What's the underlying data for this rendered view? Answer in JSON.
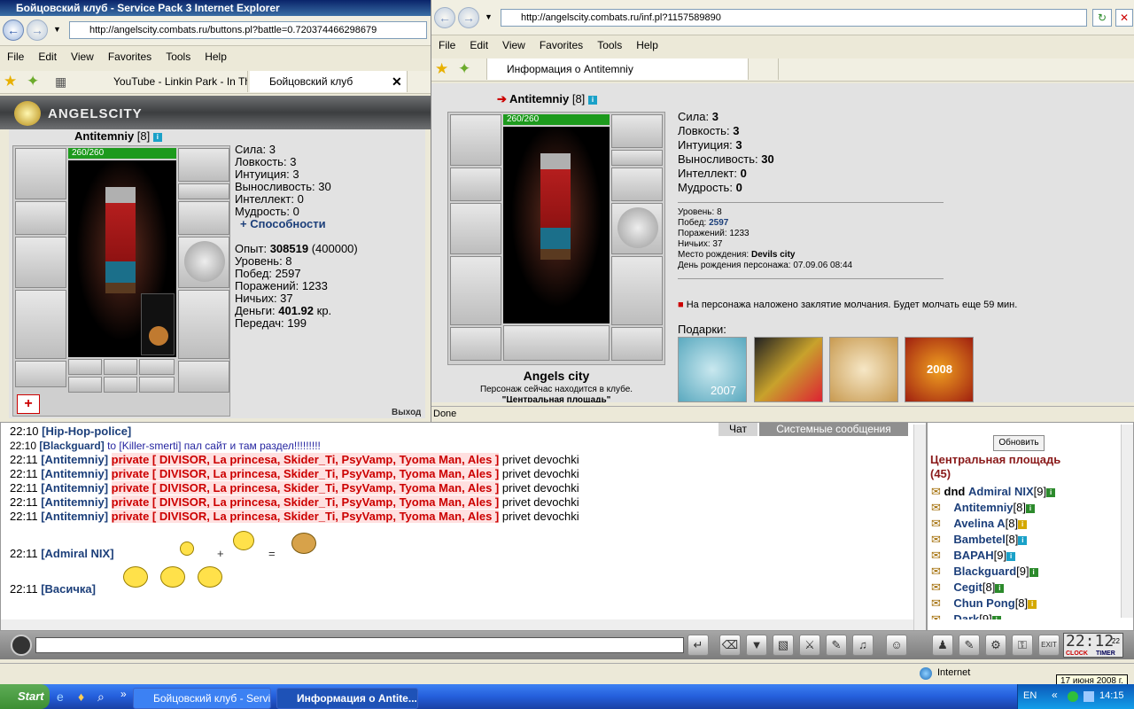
{
  "left_window": {
    "title": "Бойцовский клуб - Service Pack 3 Internet Explorer",
    "address": "http://angelscity.combats.ru/buttons.pl?battle=0.720374466298679",
    "menu": [
      "File",
      "Edit",
      "View",
      "Favorites",
      "Tools",
      "Help"
    ],
    "tabs": [
      "YouTube - Linkin Park - In Th...",
      "Бойцовский клуб"
    ],
    "site_logo": "ANGELSCITY",
    "character": {
      "name": "Antitemniy",
      "level": "[8]",
      "hp": "260/260"
    },
    "stats": [
      {
        "label": "Сила:",
        "value": "3"
      },
      {
        "label": "Ловкость:",
        "value": "3"
      },
      {
        "label": "Интуиция:",
        "value": "3"
      },
      {
        "label": "Выносливость:",
        "value": "30"
      },
      {
        "label": "Интеллект:",
        "value": "0"
      },
      {
        "label": "Мудрость:",
        "value": "0"
      }
    ],
    "abilities_link": "+ Способности",
    "exp_label": "Опыт:",
    "exp_value": "308519",
    "exp_next": "(400000)",
    "level_line": "Уровень: 8",
    "wins_line": "Побед: 2597",
    "losses_line": "Поражений: 1233",
    "draws_line": "Ничьих: 37",
    "money_label": "Деньги:",
    "money_value": "401.92",
    "money_unit": "кр.",
    "transfers_line": "Передач: 199",
    "exit_text": "Выход"
  },
  "right_window": {
    "address": "http://angelscity.combats.ru/inf.pl?1157589890",
    "menu": [
      "File",
      "Edit",
      "View",
      "Favorites",
      "Tools",
      "Help"
    ],
    "tab": "Информация о Antitemniy",
    "character": {
      "name": "Antitemniy",
      "level": "[8]",
      "hp": "260/260"
    },
    "stats": [
      {
        "label": "Сила:",
        "value": "3"
      },
      {
        "label": "Ловкость:",
        "value": "3"
      },
      {
        "label": "Интуиция:",
        "value": "3"
      },
      {
        "label": "Выносливость:",
        "value": "30"
      },
      {
        "label": "Интеллект:",
        "value": "0"
      },
      {
        "label": "Мудрость:",
        "value": "0"
      }
    ],
    "level_line": "Уровень: 8",
    "wins_label": "Побед:",
    "wins_value": "2597",
    "losses_line": "Поражений: 1233",
    "draws_line": "Ничьих: 37",
    "birthplace_label": "Место рождения:",
    "birthplace_value": "Devils city",
    "birthday_line": "День рождения персонажа: 07.09.06 08:44",
    "silence_text": "На персонажа наложено заклятие молчания. Будет молчать еще 59 мин.",
    "gifts_label": "Подарки:",
    "gift_texts": [
      "2007",
      "2008"
    ],
    "city_name": "Angels city",
    "location_text": "Персонаж сейчас находится в клубе.",
    "location_place": "\"Центральная площадь\"",
    "status": "Done"
  },
  "chat": {
    "tabs": [
      "Чат",
      "Системные сообщения"
    ],
    "lines": [
      {
        "time": "22:10",
        "nick": "[Hip-Hop-police]",
        "target": "",
        "text": ""
      },
      {
        "time": "22:10",
        "nick": "[Blackguard]",
        "target": "to [Killer-smerti]",
        "text": "пал сайт и там раздел!!!!!!!!!"
      },
      {
        "time": "22:11",
        "nick": "[Antitemniy]",
        "target": "private [ DIVISOR, La princesa, Skider_Ti, PsyVamp, Tyoma Man, Ales ]",
        "text": "privet devochki"
      },
      {
        "time": "22:11",
        "nick": "[Antitemniy]",
        "target": "private [ DIVISOR, La princesa, Skider_Ti, PsyVamp, Tyoma Man, Ales ]",
        "text": "privet devochki"
      },
      {
        "time": "22:11",
        "nick": "[Antitemniy]",
        "target": "private [ DIVISOR, La princesa, Skider_Ti, PsyVamp, Tyoma Man, Ales ]",
        "text": "privet devochki"
      },
      {
        "time": "22:11",
        "nick": "[Antitemniy]",
        "target": "private [ DIVISOR, La princesa, Skider_Ti, PsyVamp, Tyoma Man, Ales ]",
        "text": "privet devochki"
      },
      {
        "time": "22:11",
        "nick": "[Antitemniy]",
        "target": "private [ DIVISOR, La princesa, Skider_Ti, PsyVamp, Tyoma Man, Ales ]",
        "text": "privet devochki"
      }
    ],
    "smiley_lines": [
      {
        "time": "22:11",
        "nick": "[Admiral NIX]",
        "plus": "+",
        "equals": "="
      },
      {
        "time": "22:11",
        "nick": "[Васичка]"
      }
    ]
  },
  "users": {
    "refresh_button": "Обновить",
    "room": "Центральная площадь",
    "count": "(45)",
    "list": [
      {
        "prefix": "dnd",
        "name": "Admiral NIX",
        "level": "[9]"
      },
      {
        "prefix": "",
        "name": "Antitemniy",
        "level": "[8]"
      },
      {
        "prefix": "",
        "name": "Avelina A",
        "level": "[8]"
      },
      {
        "prefix": "",
        "name": "Bambetel",
        "level": "[8]"
      },
      {
        "prefix": "",
        "name": "BAPAH",
        "level": "[9]"
      },
      {
        "prefix": "",
        "name": "Blackguard",
        "level": "[9]"
      },
      {
        "prefix": "",
        "name": "Cegit",
        "level": "[8]"
      },
      {
        "prefix": "",
        "name": "Chun Pong",
        "level": "[8]"
      },
      {
        "prefix": "",
        "name": "Dark",
        "level": "[9]"
      }
    ]
  },
  "clock": {
    "time": "22:12",
    "seconds": "22",
    "clock_label": "CLOCK",
    "timer_label": "TIMER"
  },
  "ie_status": {
    "zone": "Internet",
    "date_tooltip": "17 июня 2008 г."
  },
  "taskbar": {
    "start": "Start",
    "buttons": [
      "Бойцовский клуб - Servi...",
      "Информация о Antite..."
    ],
    "lang": "EN",
    "time": "14:15"
  }
}
